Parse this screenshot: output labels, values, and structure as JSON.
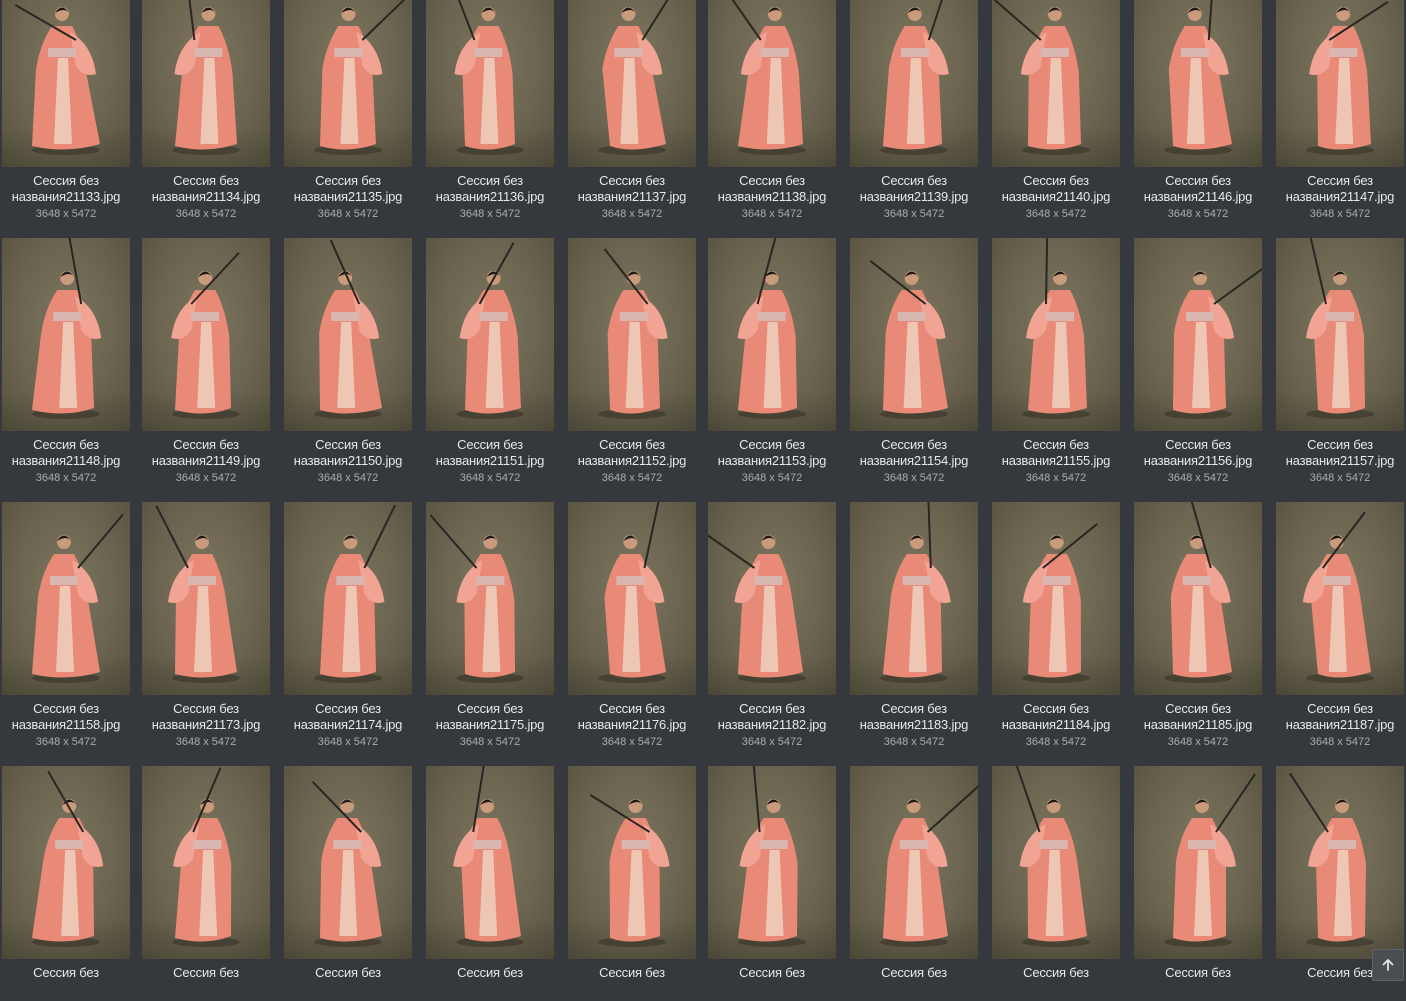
{
  "gallery": {
    "dims_label": "3648 x 5472",
    "rows": [
      [
        {
          "name_line1": "Сессия без",
          "name_line2": "названия21133.jpg"
        },
        {
          "name_line1": "Сессия без",
          "name_line2": "названия21134.jpg"
        },
        {
          "name_line1": "Сессия без",
          "name_line2": "названия21135.jpg"
        },
        {
          "name_line1": "Сессия без",
          "name_line2": "названия21136.jpg"
        },
        {
          "name_line1": "Сессия без",
          "name_line2": "названия21137.jpg"
        },
        {
          "name_line1": "Сессия без",
          "name_line2": "названия21138.jpg"
        },
        {
          "name_line1": "Сессия без",
          "name_line2": "названия21139.jpg"
        },
        {
          "name_line1": "Сессия без",
          "name_line2": "названия21140.jpg"
        },
        {
          "name_line1": "Сессия без",
          "name_line2": "названия21146.jpg"
        },
        {
          "name_line1": "Сессия без",
          "name_line2": "названия21147.jpg"
        }
      ],
      [
        {
          "name_line1": "Сессия без",
          "name_line2": "названия21148.jpg"
        },
        {
          "name_line1": "Сессия без",
          "name_line2": "названия21149.jpg"
        },
        {
          "name_line1": "Сессия без",
          "name_line2": "названия21150.jpg"
        },
        {
          "name_line1": "Сессия без",
          "name_line2": "названия21151.jpg"
        },
        {
          "name_line1": "Сессия без",
          "name_line2": "названия21152.jpg"
        },
        {
          "name_line1": "Сессия без",
          "name_line2": "названия21153.jpg"
        },
        {
          "name_line1": "Сессия без",
          "name_line2": "названия21154.jpg"
        },
        {
          "name_line1": "Сессия без",
          "name_line2": "названия21155.jpg"
        },
        {
          "name_line1": "Сессия без",
          "name_line2": "названия21156.jpg"
        },
        {
          "name_line1": "Сессия без",
          "name_line2": "названия21157.jpg"
        }
      ],
      [
        {
          "name_line1": "Сессия без",
          "name_line2": "названия21158.jpg"
        },
        {
          "name_line1": "Сессия без",
          "name_line2": "названия21173.jpg"
        },
        {
          "name_line1": "Сессия без",
          "name_line2": "названия21174.jpg"
        },
        {
          "name_line1": "Сессия без",
          "name_line2": "названия21175.jpg"
        },
        {
          "name_line1": "Сессия без",
          "name_line2": "названия21176.jpg"
        },
        {
          "name_line1": "Сессия без",
          "name_line2": "названия21182.jpg"
        },
        {
          "name_line1": "Сессия без",
          "name_line2": "названия21183.jpg"
        },
        {
          "name_line1": "Сессия без",
          "name_line2": "названия21184.jpg"
        },
        {
          "name_line1": "Сессия без",
          "name_line2": "названия21185.jpg"
        },
        {
          "name_line1": "Сессия без",
          "name_line2": "названия21187.jpg"
        }
      ],
      [
        {
          "name_line1": "Сессия без"
        },
        {
          "name_line1": "Сессия без"
        },
        {
          "name_line1": "Сессия без"
        },
        {
          "name_line1": "Сессия без"
        },
        {
          "name_line1": "Сессия без"
        },
        {
          "name_line1": "Сессия без"
        },
        {
          "name_line1": "Сессия без"
        },
        {
          "name_line1": "Сессия без"
        },
        {
          "name_line1": "Сессия без"
        },
        {
          "name_line1": "Сессия без"
        }
      ]
    ]
  },
  "colors": {
    "background": "#35383d",
    "kimono": "#e98a78",
    "backdrop": "#6a6450"
  },
  "scroll_top_icon": "arrow-up-icon"
}
